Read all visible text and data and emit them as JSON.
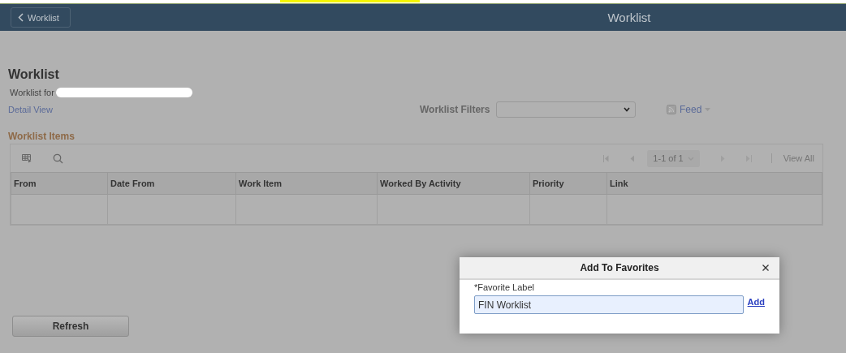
{
  "header": {
    "back_button": "Worklist",
    "title": "Worklist"
  },
  "page": {
    "title": "Worklist",
    "owner_label": "Worklist for",
    "detail_link": "Detail View",
    "filters_label": "Worklist Filters",
    "feed_link": "Feed"
  },
  "grid": {
    "title": "Worklist Items",
    "range": "1-1 of 1",
    "view_all": "View All",
    "columns": [
      "From",
      "Date From",
      "Work Item",
      "Worked By Activity",
      "Priority",
      "Link"
    ]
  },
  "refresh_button": "Refresh",
  "dialog": {
    "title": "Add To Favorites",
    "field_label": "*Favorite Label",
    "field_value": "FIN Worklist",
    "add_link": "Add"
  }
}
